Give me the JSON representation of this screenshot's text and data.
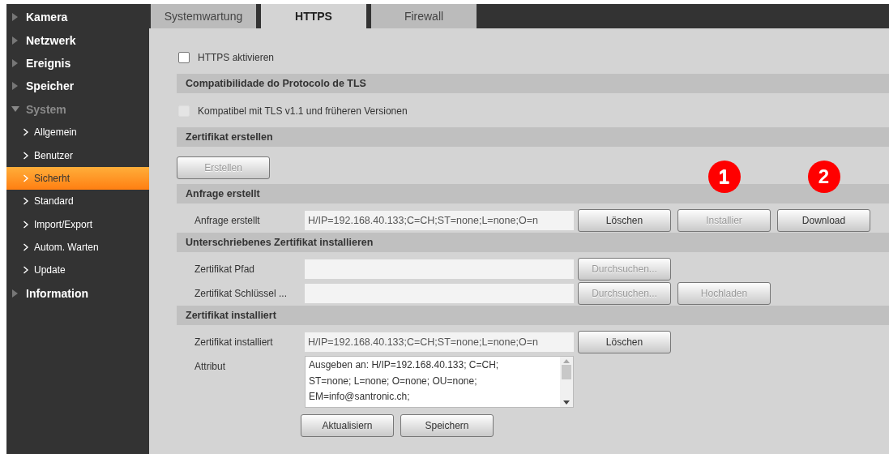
{
  "sidebar": {
    "items": [
      {
        "label": "Kamera",
        "expanded": false
      },
      {
        "label": "Netzwerk",
        "expanded": false
      },
      {
        "label": "Ereignis",
        "expanded": false
      },
      {
        "label": "Speicher",
        "expanded": false
      },
      {
        "label": "System",
        "expanded": true,
        "children": [
          {
            "label": "Allgemein",
            "selected": false
          },
          {
            "label": "Benutzer",
            "selected": false
          },
          {
            "label": "Sicherht",
            "selected": true
          },
          {
            "label": "Standard",
            "selected": false
          },
          {
            "label": "Import/Export",
            "selected": false
          },
          {
            "label": "Autom. Warten",
            "selected": false
          },
          {
            "label": "Update",
            "selected": false
          }
        ]
      },
      {
        "label": "Information",
        "expanded": false
      }
    ]
  },
  "tabs": [
    {
      "label": "Systemwartung",
      "selected": false
    },
    {
      "label": "HTTPS",
      "selected": true
    },
    {
      "label": "Firewall",
      "selected": false
    }
  ],
  "rows": [
    {
      "kind": "checkbox",
      "label": "HTTPS aktivieren",
      "checked": false,
      "disabled": false
    },
    {
      "kind": "header",
      "label": "Compatibilidade do Protocolo de TLS"
    },
    {
      "kind": "checkbox",
      "label": "Kompatibel mit TLS v1.1 und früheren Versionen",
      "checked": false,
      "disabled": true
    },
    {
      "kind": "header",
      "label": "Zertifikat erstellen"
    },
    {
      "kind": "buttons",
      "buttons": [
        {
          "label": "Erstellen",
          "disabled": true
        }
      ]
    },
    {
      "kind": "header",
      "label": "Anfrage erstellt"
    },
    {
      "kind": "field",
      "label": "Anfrage erstellt",
      "value": "H/IP=192.168.40.133;C=CH;ST=none;L=none;O=n",
      "buttons": [
        {
          "label": "Löschen",
          "disabled": false
        },
        {
          "label": "Installier",
          "disabled": true,
          "marker": "1"
        },
        {
          "label": "Download",
          "disabled": false,
          "marker": "2"
        }
      ]
    },
    {
      "kind": "header",
      "label": "Unterschriebenes Zertifikat installieren"
    },
    {
      "kind": "field",
      "label": "Zertifikat Pfad",
      "value": "",
      "buttons": [
        {
          "label": "Durchsuchen...",
          "disabled": true
        }
      ]
    },
    {
      "kind": "field",
      "label": "Zertifikat Schlüssel ...",
      "value": "",
      "buttons": [
        {
          "label": "Durchsuchen...",
          "disabled": true
        },
        {
          "label": "Hochladen",
          "disabled": true
        }
      ]
    },
    {
      "kind": "header",
      "label": "Zertifikat installiert"
    },
    {
      "kind": "field",
      "label": "Zertifikat installiert",
      "value": "H/IP=192.168.40.133;C=CH;ST=none;L=none;O=n",
      "buttons": [
        {
          "label": "Löschen",
          "disabled": false
        }
      ]
    },
    {
      "kind": "textarea",
      "label": "Attribut",
      "lines": [
        "Ausgeben an: H/IP=192.168.40.133; C=CH;",
        "ST=none; L=none; O=none; OU=none;",
        "EM=info@santronic.ch;"
      ]
    },
    {
      "kind": "buttons",
      "buttons": [
        {
          "label": "Aktualisiern",
          "disabled": false
        },
        {
          "label": "Speichern",
          "disabled": false
        }
      ]
    }
  ]
}
